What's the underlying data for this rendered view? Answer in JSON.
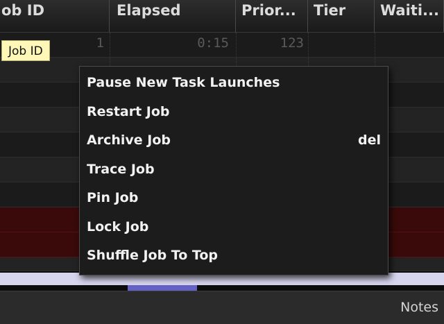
{
  "columns": [
    {
      "key": "job_id",
      "label": "ob ID"
    },
    {
      "key": "elapsed",
      "label": "Elapsed"
    },
    {
      "key": "priority",
      "label": "Prior..."
    },
    {
      "key": "tier",
      "label": "Tier"
    },
    {
      "key": "waiting",
      "label": "Waiti..."
    }
  ],
  "rows": [
    {
      "id": "1",
      "elapsed": "0:15",
      "priority": "123"
    }
  ],
  "tooltip": "Job ID",
  "context_menu": {
    "items": [
      {
        "label": "Pause New Task Launches",
        "shortcut": ""
      },
      {
        "label": "Restart Job",
        "shortcut": ""
      },
      {
        "label": "Archive Job",
        "shortcut": "del"
      },
      {
        "label": "Trace Job",
        "shortcut": ""
      },
      {
        "label": "Pin Job",
        "shortcut": ""
      },
      {
        "label": "Lock Job",
        "shortcut": ""
      },
      {
        "label": "Shuffle Job To Top",
        "shortcut": ""
      }
    ]
  },
  "footer": {
    "notes_label": "Notes"
  },
  "colors": {
    "highlight_row": "#3a0a0a",
    "selection": "#d7d5ee",
    "scroll_thumb": "#6462c4",
    "tooltip_bg": "#fff7b8"
  }
}
